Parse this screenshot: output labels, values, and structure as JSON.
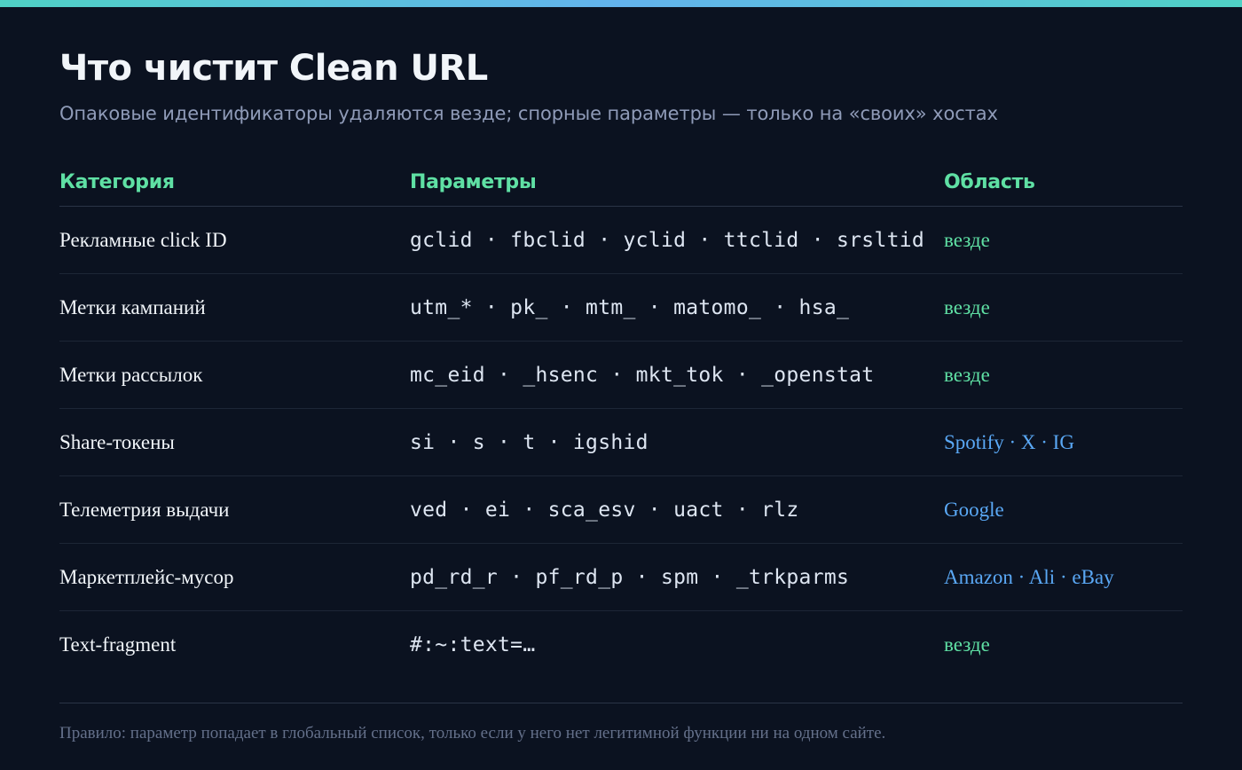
{
  "colors": {
    "background": "#0b1220",
    "heading": "#f1f5f9",
    "subtitle": "#8f9bb8",
    "header_accent": "#5fe0a4",
    "scope_everywhere": "#5fe0a4",
    "scope_hosts": "#5aa8f5",
    "note": "#64708a"
  },
  "title": "Что чистит Clean URL",
  "subtitle": "Опаковые идентификаторы удаляются везде; спорные параметры — только на «своих» хостах",
  "table": {
    "headers": [
      "Категория",
      "Параметры",
      "Область"
    ],
    "rows": [
      {
        "category": "Рекламные click ID",
        "params": "gclid · fbclid · yclid · ttclid · srsltid",
        "scope": "везде",
        "scope_type": "everywhere"
      },
      {
        "category": "Метки кампаний",
        "params": "utm_* · pk_ · mtm_ · matomo_ · hsa_",
        "scope": "везде",
        "scope_type": "everywhere"
      },
      {
        "category": "Метки рассылок",
        "params": "mc_eid · _hsenc · mkt_tok · _openstat",
        "scope": "везде",
        "scope_type": "everywhere"
      },
      {
        "category": "Share-токены",
        "params": "si · s · t · igshid",
        "scope": "Spotify · X · IG",
        "scope_type": "hosts"
      },
      {
        "category": "Телеметрия выдачи",
        "params": "ved · ei · sca_esv · uact · rlz",
        "scope": "Google",
        "scope_type": "hosts"
      },
      {
        "category": "Маркетплейс-мусор",
        "params": "pd_rd_r · pf_rd_p · spm · _trkparms",
        "scope": "Amazon · Ali · eBay",
        "scope_type": "hosts"
      },
      {
        "category": "Text-fragment",
        "params": "#:~:text=…",
        "scope": "везде",
        "scope_type": "everywhere"
      }
    ]
  },
  "note": "Правило: параметр попадает в глобальный список, только если у него нет легитимной функции ни на одном сайте."
}
